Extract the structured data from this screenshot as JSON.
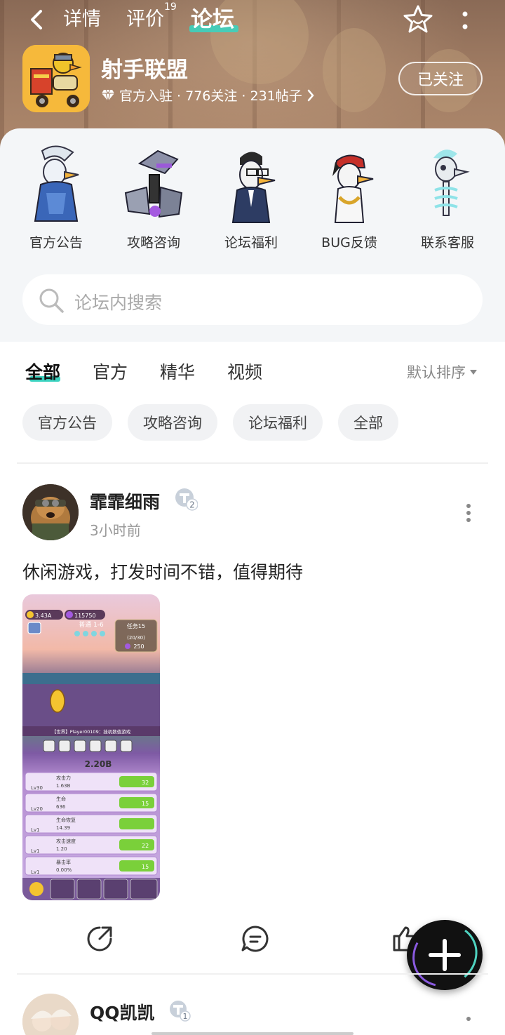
{
  "topbar": {
    "tabs": [
      {
        "label": "详情"
      },
      {
        "label": "评价",
        "badge": "19"
      },
      {
        "label": "论坛"
      }
    ],
    "active_tab": "论坛"
  },
  "forum": {
    "title": "射手联盟",
    "meta": "官方入驻 · 776关注 · 231帖子",
    "follow_label": "已关注"
  },
  "shortcuts": [
    {
      "label": "官方公告",
      "icon": "blue-duck-icon"
    },
    {
      "label": "攻略咨询",
      "icon": "robot-duck-icon"
    },
    {
      "label": "论坛福利",
      "icon": "glasses-duck-icon"
    },
    {
      "label": "BUG反馈",
      "icon": "bandana-duck-icon"
    },
    {
      "label": "联系客服",
      "icon": "skeleton-duck-icon"
    }
  ],
  "search": {
    "placeholder": "论坛内搜索"
  },
  "filter_tabs": [
    {
      "label": "全部"
    },
    {
      "label": "官方"
    },
    {
      "label": "精华"
    },
    {
      "label": "视频"
    }
  ],
  "sort_label": "默认排序",
  "chips": [
    {
      "label": "官方公告"
    },
    {
      "label": "攻略咨询"
    },
    {
      "label": "论坛福利"
    },
    {
      "label": "全部"
    }
  ],
  "post": {
    "author": "霏霏细雨",
    "level": "2",
    "time": "3小时前",
    "text": "休闲游戏，打发时间不错，值得期待",
    "screenshot": {
      "currency_1": "3.43A",
      "currency_2": "115750",
      "stage": "普通 1-6",
      "task": "任务15",
      "task_progress": "(20/30)",
      "task_reward": "250",
      "chat": "【世界】Player00109：挂机数值游戏",
      "power": "2.20B",
      "rows": [
        {
          "name": "攻击力",
          "value": "1.63B",
          "level": "Lv30",
          "cost": "32"
        },
        {
          "name": "生命",
          "value": "636",
          "level": "Lv20",
          "cost": "15"
        },
        {
          "name": "生命恢复",
          "value": "14.39",
          "level": "Lv1",
          "cost": ""
        },
        {
          "name": "攻击速度",
          "value": "1.20",
          "level": "Lv1",
          "cost": "22"
        },
        {
          "name": "暴击率",
          "value": "0.00%",
          "level": "Lv1",
          "cost": "15"
        }
      ]
    }
  },
  "post2": {
    "author": "QQ凯凯",
    "level": "1"
  },
  "colors": {
    "accent": "#3bd3c0",
    "fab": "#111111"
  }
}
